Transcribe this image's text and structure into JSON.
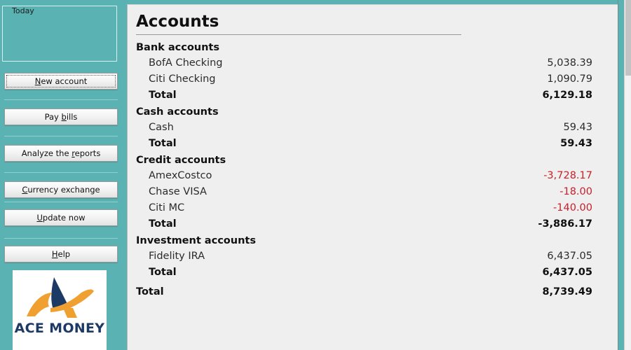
{
  "app": {
    "name": "ACE MONEY",
    "accent_teal": "#5bb2b2",
    "panel_bg": "#efeff0",
    "negative_color": "#c8202a"
  },
  "sidebar": {
    "group": {
      "title": "Today"
    },
    "buttons": [
      {
        "label": "New account",
        "pre": "",
        "mnemonic": "N",
        "post": "ew account",
        "focused": true
      },
      {
        "label": "Pay bills",
        "pre": "Pay ",
        "mnemonic": "b",
        "post": "ills",
        "focused": false
      },
      {
        "label": "Analyze the reports",
        "pre": "Analyze the ",
        "mnemonic": "r",
        "post": "eports",
        "focused": false
      },
      {
        "label": "Currency exchange",
        "pre": "",
        "mnemonic": "C",
        "post": "urrency exchange",
        "focused": false
      },
      {
        "label": "Update now",
        "pre": "",
        "mnemonic": "U",
        "post": "pdate now",
        "focused": false
      },
      {
        "label": "Help",
        "pre": "",
        "mnemonic": "H",
        "post": "elp",
        "focused": false
      }
    ],
    "logo": {
      "text": "ACE MONEY",
      "navy": "#1c3a63",
      "orange": "#f0a030"
    }
  },
  "main": {
    "title": "Accounts",
    "sections": [
      {
        "heading": "Bank accounts",
        "rows": [
          {
            "name": "BofA Checking",
            "amount": "5,038.39",
            "negative": false
          },
          {
            "name": "Citi Checking",
            "amount": "1,090.79",
            "negative": false
          }
        ],
        "total": {
          "name": "Total",
          "amount": "6,129.18",
          "negative": false
        }
      },
      {
        "heading": "Cash accounts",
        "rows": [
          {
            "name": "Cash",
            "amount": "59.43",
            "negative": false
          }
        ],
        "total": {
          "name": "Total",
          "amount": "59.43",
          "negative": false
        }
      },
      {
        "heading": "Credit accounts",
        "rows": [
          {
            "name": "AmexCostco",
            "amount": "-3,728.17",
            "negative": true
          },
          {
            "name": "Chase VISA",
            "amount": "-18.00",
            "negative": true
          },
          {
            "name": "Citi MC",
            "amount": "-140.00",
            "negative": true
          }
        ],
        "total": {
          "name": "Total",
          "amount": "-3,886.17",
          "negative": true
        }
      },
      {
        "heading": "Investment accounts",
        "rows": [
          {
            "name": "Fidelity IRA",
            "amount": "6,437.05",
            "negative": false
          }
        ],
        "total": {
          "name": "Total",
          "amount": "6,437.05",
          "negative": false
        }
      }
    ],
    "grand_total": {
      "name": "Total",
      "amount": "8,739.49",
      "negative": false
    }
  }
}
